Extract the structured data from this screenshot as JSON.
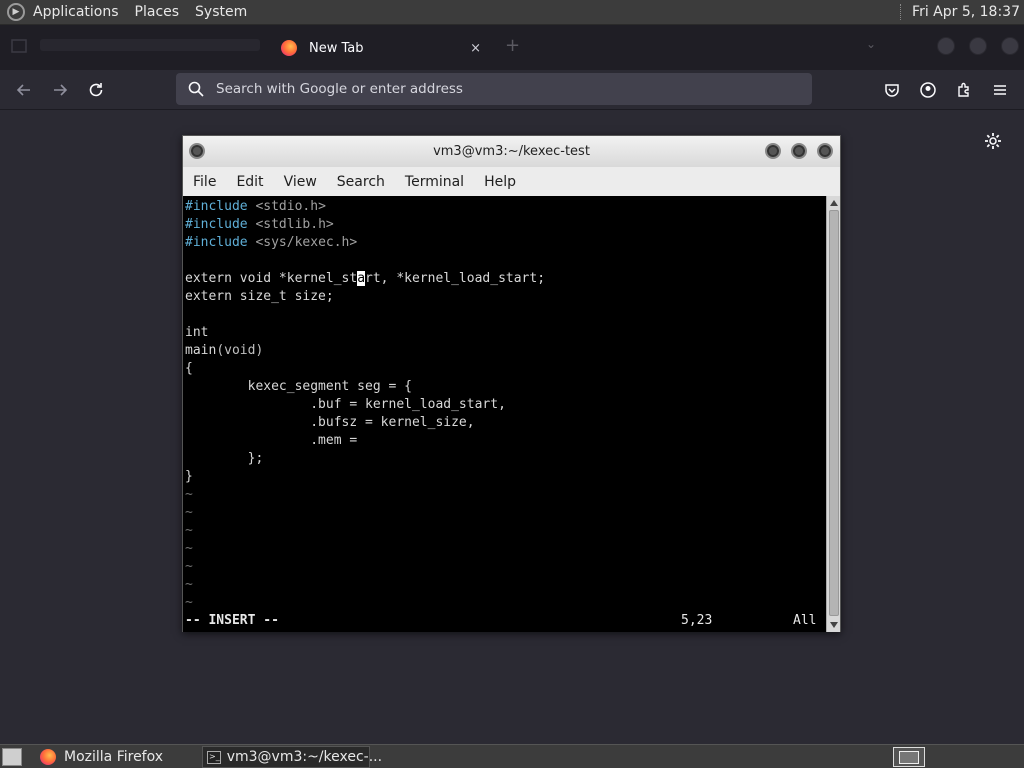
{
  "top_panel": {
    "menus": [
      "Applications",
      "Places",
      "System"
    ],
    "clock": "Fri Apr  5, 18:37"
  },
  "browser": {
    "tab_title": "New Tab",
    "tab_close": "×",
    "new_tab": "+",
    "url_placeholder": "Search with Google or enter address"
  },
  "terminal": {
    "title": "vm3@vm3:~/kexec-test",
    "menu": [
      "File",
      "Edit",
      "View",
      "Search",
      "Terminal",
      "Help"
    ],
    "status": {
      "mode": "-- INSERT --",
      "position": "5,23",
      "scroll": "All"
    },
    "tilde_lines": 7
  },
  "code": {
    "include1_kw": "#include",
    "include1_hdr": "<stdio.h>",
    "include2_kw": "#include",
    "include2_hdr": "<stdlib.h>",
    "include3_kw": "#include",
    "include3_hdr": "<sys/kexec.h>",
    "l5_pre": "extern void *kernel_st",
    "l5_cursor": "a",
    "l5_post": "rt, *kernel_load_start;",
    "l6": "extern size_t size;",
    "l8": "int",
    "l9_name": "main",
    "l9_args": "(void)",
    "l10": "{",
    "l11": "        kexec_segment seg = {",
    "l12": "                .buf = kernel_load_start,",
    "l13": "                .bufsz = kernel_size,",
    "l14": "                .mem = ",
    "l15": "        };",
    "l16": "}"
  },
  "taskbar": {
    "firefox_label": "Mozilla Firefox",
    "terminal_label": "vm3@vm3:~/kexec-..."
  }
}
